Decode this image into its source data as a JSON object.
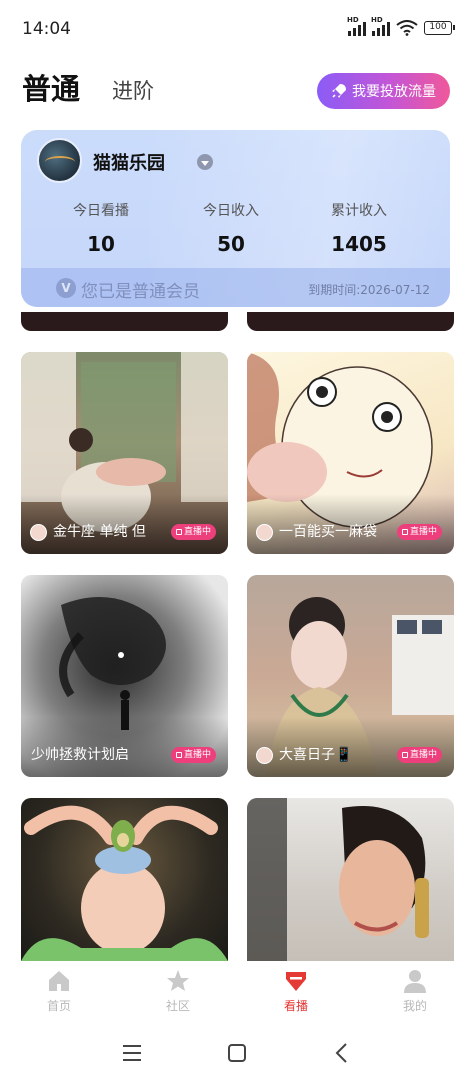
{
  "status_bar": {
    "time": "14:04",
    "hd1": "HD",
    "hd2": "HD",
    "battery": "100"
  },
  "header": {
    "tab_normal": "普通",
    "tab_advanced": "进阶",
    "promo_button": "我要投放流量"
  },
  "account": {
    "name": "猫猫乐园",
    "stats": [
      {
        "label": "今日看播",
        "value": "10"
      },
      {
        "label": "今日收入",
        "value": "50"
      },
      {
        "label": "累计收入",
        "value": "1405"
      }
    ],
    "vip_icon_text": "V",
    "vip_text": "您已是普通会员",
    "expire_label": "到期时间:2026-07-12"
  },
  "live_badge": "直播中",
  "streams": [
    {
      "title": "金牛座 单纯 但",
      "badge": "直播中"
    },
    {
      "title": "一百能买一麻袋",
      "badge": "直播中"
    },
    {
      "title": "少帅拯救计划启",
      "badge": "直播中"
    },
    {
      "title": "大喜日子📱",
      "badge": "直播中"
    },
    {
      "title": "",
      "badge": ""
    },
    {
      "title": "",
      "badge": ""
    }
  ],
  "bottom_nav": [
    {
      "label": "首页",
      "icon": "home-icon"
    },
    {
      "label": "社区",
      "icon": "star-icon"
    },
    {
      "label": "看播",
      "icon": "gem-icon",
      "active": true
    },
    {
      "label": "我的",
      "icon": "user-icon"
    }
  ],
  "colors": {
    "accent": "#e53935",
    "live": "#ee3f7d",
    "card": "#c5d6fa"
  }
}
